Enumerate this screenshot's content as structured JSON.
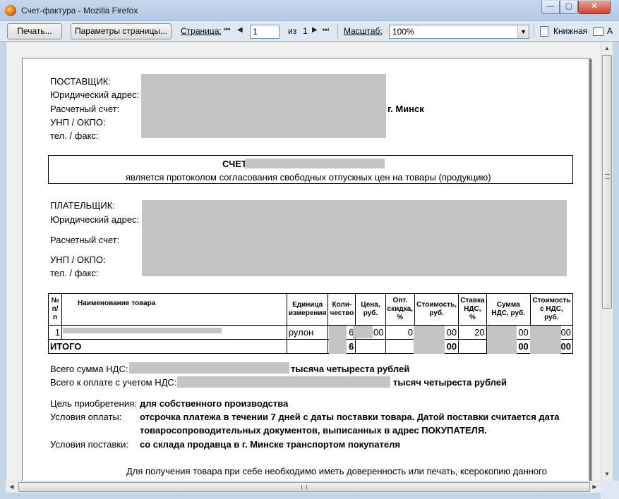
{
  "window": {
    "title": "Счет-фактура - Mozilla Firefox",
    "min_glyph": "—",
    "max_glyph": "▢",
    "close_glyph": "✕"
  },
  "toolbar": {
    "print_label": "Печать...",
    "page_setup_label": "Параметры страницы...",
    "page_label": "Страница:",
    "page_value": "1",
    "of_label": "из",
    "total_pages": "1",
    "scale_label": "Масштаб:",
    "scale_value": "100%",
    "portrait_label": "Книжная",
    "landscape_label": "А",
    "first_glyph": "⏮",
    "prev_glyph": "◀",
    "next_glyph": "▶",
    "last_glyph": "⏭"
  },
  "supplier": {
    "heading": "ПОСТАВЩИК:",
    "address_label": "Юридический адрес:",
    "account_label": "Расчетный счет:",
    "city_suffix": "г. Минск",
    "unp_label": "УНП / ОКПО:",
    "phone_label": "тел. / факс:"
  },
  "invoice": {
    "title": "СЧЕТ",
    "subtitle": "является протоколом согласования свободных отпускных цен на товары (продукцию)"
  },
  "payer": {
    "heading": "ПЛАТЕЛЬЩИК:",
    "address_label": "Юридический адрес:",
    "account_label": "Расчетный счет:",
    "unp_label": "УНП / ОКПО:",
    "phone_label": "тел. / факс:"
  },
  "table": {
    "headers": [
      "№ п/п",
      "Наименование товара",
      "Единица измерения",
      "Коли-чество",
      "Цена, руб.",
      "Опт. скидка, %",
      "Стоимость, руб.",
      "Ставка НДС, %",
      "Сумма НДС, руб.",
      "Стоимость с НДС, руб."
    ],
    "rows": [
      {
        "num": "1",
        "name": "",
        "unit": "рулон",
        "qty": "6",
        "price": "00",
        "discount": "0",
        "cost": "00",
        "vat_rate": "20",
        "vat_sum": "00",
        "total": "00"
      }
    ],
    "total_row": {
      "label": "ИТОГО",
      "qty": "6",
      "cost": "00",
      "vat_sum": "00",
      "total": "00"
    }
  },
  "totals": {
    "vat_label": "Всего сумма НДС:",
    "vat_words": "тысяча четыреста рублей",
    "pay_label": "Всего к оплате с учетом НДС:",
    "pay_words": "тысяч четыреста рублей"
  },
  "terms": {
    "purpose_label": "Цель приобретения:",
    "purpose_value": "для собственного производства",
    "payment_label": "Условия оплаты:",
    "payment_value_line1": "отсрочка платежа в течении 7 дней с даты поставки товара. Датой поставки считается дата",
    "payment_value_line2": "товаросопроводительных документов, выписанных в адрес ПОКУПАТЕЛЯ.",
    "delivery_label": "Условия поставки:",
    "delivery_value": "со склада продавца в г. Минске транспортом покупателя"
  },
  "footer_note": "Для получения товара при себе необходимо иметь доверенность или печать, ксерокопию данного",
  "colors": {
    "redaction": "#c4c4c4",
    "chrome": "#c4d7ee"
  }
}
